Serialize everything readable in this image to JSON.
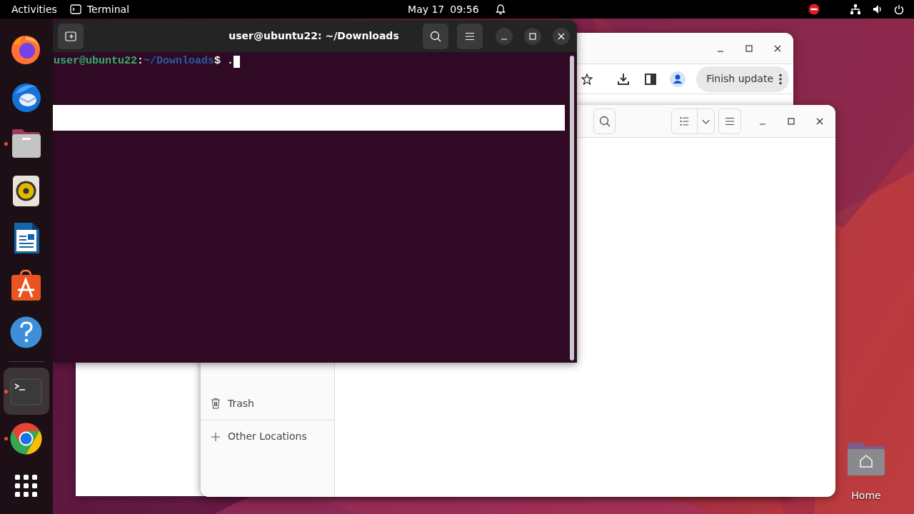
{
  "top_bar": {
    "activities": "Activities",
    "app": "Terminal",
    "date": "May 17",
    "time": "09:56"
  },
  "dock": {
    "pinned": [
      {
        "kind": "firefox",
        "running": false,
        "selected": false
      },
      {
        "kind": "thunderbird",
        "running": false,
        "selected": false
      },
      {
        "kind": "files",
        "running": true,
        "selected": false
      },
      {
        "kind": "rhythmbox",
        "running": false,
        "selected": false
      },
      {
        "kind": "writer",
        "running": false,
        "selected": false
      },
      {
        "kind": "software",
        "running": false,
        "selected": false
      },
      {
        "kind": "help",
        "running": false,
        "selected": false
      }
    ],
    "other": [
      {
        "kind": "terminal",
        "running": true,
        "selected": true
      },
      {
        "kind": "chrome",
        "running": true,
        "selected": false
      }
    ]
  },
  "browser_window": {
    "update_button": "Finish update"
  },
  "files_window": {
    "sidebar": [
      {
        "kind": "trash",
        "label": "Trash"
      },
      {
        "kind": "other",
        "label": "Other Locations"
      }
    ]
  },
  "terminal_window": {
    "title": "user@ubuntu22: ~/Downloads",
    "prompt_user": "user@ubuntu22",
    "prompt_sep": ":",
    "prompt_path": "~/Downloads",
    "prompt_symbol": "$",
    "command": "."
  },
  "desktop_icons": [
    {
      "label": "Home"
    }
  ]
}
